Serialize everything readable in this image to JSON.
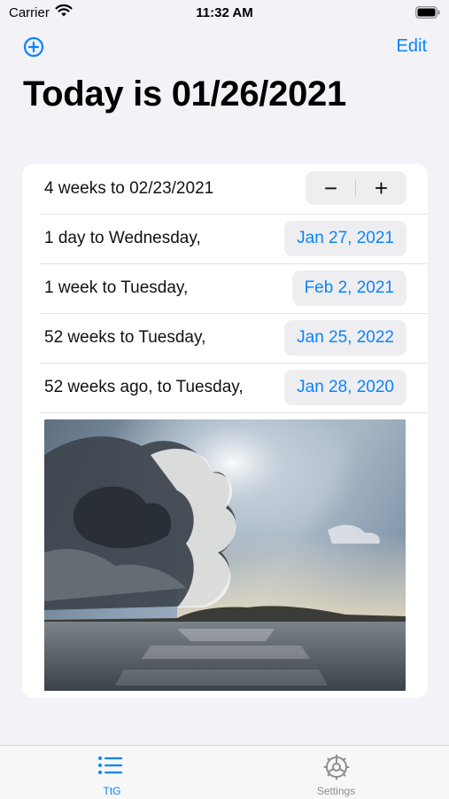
{
  "status_bar": {
    "carrier": "Carrier",
    "time": "11:32 AM"
  },
  "nav": {
    "edit_label": "Edit",
    "accent_color": "#0a84ff"
  },
  "title": "Today is 01/26/2021",
  "rows": [
    {
      "label": "4 weeks to 02/23/2021",
      "control": "stepper",
      "minus": "−",
      "plus": "+"
    },
    {
      "label": "1 day to Wednesday,",
      "date": "Jan 27, 2021"
    },
    {
      "label": "1 week to Tuesday,",
      "date": "Feb 2, 2021"
    },
    {
      "label": "52 weeks to Tuesday,",
      "date": "Jan 25, 2022"
    },
    {
      "label": "52 weeks ago, to Tuesday,",
      "date": "Jan 28, 2020"
    }
  ],
  "photo": {
    "icon": "landscape-photo"
  },
  "tab_bar": {
    "tabs": [
      {
        "label": "TtG",
        "icon": "list-icon",
        "selected": true
      },
      {
        "label": "Settings",
        "icon": "gear-icon",
        "selected": false
      }
    ]
  }
}
